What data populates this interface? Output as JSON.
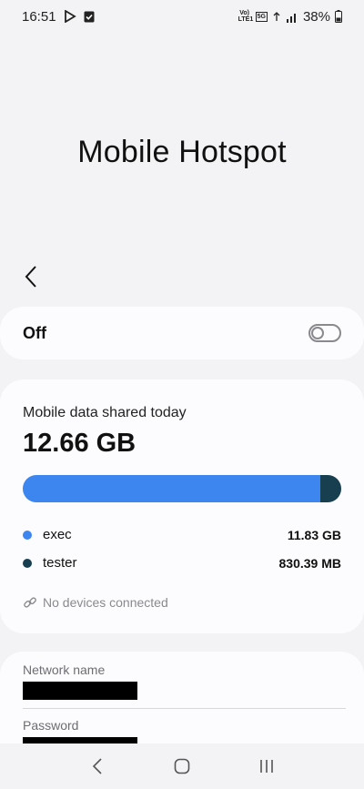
{
  "status_bar": {
    "time": "16:51",
    "battery": "38%",
    "network_badge": "5G",
    "volte": "Vo) LTE1",
    "icons": [
      "play-store-icon",
      "download-check-icon",
      "volte-icon",
      "5g-icon",
      "wifi-icon",
      "signal-icon",
      "battery-icon"
    ]
  },
  "page": {
    "title": "Mobile Hotspot",
    "back_icon": "chevron-left-icon"
  },
  "toggle": {
    "label": "Off",
    "state": "off"
  },
  "usage": {
    "caption": "Mobile data shared today",
    "total": "12.66 GB",
    "devices": [
      {
        "name": "exec",
        "value": "11.83 GB",
        "color": "#3d86f0",
        "fraction": 0.934
      },
      {
        "name": "tester",
        "value": "830.39 MB",
        "color": "#173f4f",
        "fraction": 0.066
      }
    ],
    "no_devices_text": "No devices connected",
    "link_icon": "link-icon"
  },
  "network": {
    "name_label": "Network name",
    "password_label": "Password"
  },
  "nav": {
    "back_icon": "back-icon",
    "home_icon": "home-icon",
    "recents_icon": "recents-icon"
  },
  "colors": {
    "background": "#f3f3f6",
    "card": "#fcfcfe",
    "accent_blue": "#3d86f0",
    "accent_dark": "#173f4f"
  }
}
